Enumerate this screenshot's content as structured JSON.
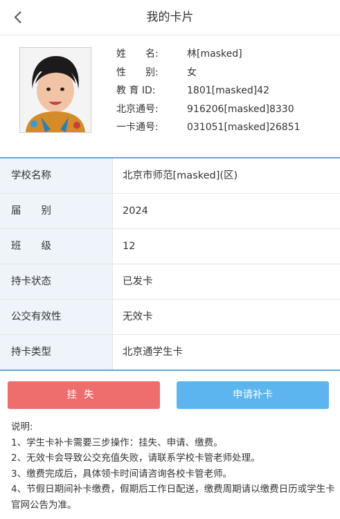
{
  "header": {
    "title": "我的卡片"
  },
  "profile": {
    "fields": [
      {
        "label": "姓　　名:",
        "value": "林[masked]"
      },
      {
        "label": "性　　别:",
        "value": "女"
      },
      {
        "label": "教 育 ID:",
        "value": "1801[masked]42"
      },
      {
        "label": "北京通号:",
        "value": "916206[masked]8330"
      },
      {
        "label": "一卡通号:",
        "value": "031051[masked]26851"
      }
    ]
  },
  "details": {
    "rows": [
      {
        "label": "学校名称",
        "value": "北京市师范[masked](区)"
      },
      {
        "label": "届　　别",
        "value": "2024"
      },
      {
        "label": "班　　级",
        "value": "12"
      },
      {
        "label": "持卡状态",
        "value": "已发卡"
      },
      {
        "label": "公交有效性",
        "value": "无效卡"
      },
      {
        "label": "持卡类型",
        "value": "北京通学生卡"
      }
    ]
  },
  "actions": {
    "report_loss": "挂失",
    "apply_replace": "申请补卡"
  },
  "notes": {
    "heading": "说明:",
    "lines": [
      "1、学生卡补卡需要三步操作：挂失、申请、缴费。",
      "2、无效卡会导致公交充值失败，请联系学校卡管老师处理。",
      "3、缴费完成后，具体领卡时间请咨询各校卡管老师。",
      "4、节假日期间补卡缴费，假期后工作日配送，缴费周期请以缴费日历或学生卡官网公告为准。"
    ]
  },
  "colors": {
    "accent_blue": "#5aa9e6",
    "loss_red": "#ee6e6e",
    "apply_blue": "#5db5ef",
    "label_bg": "#eef4fa"
  }
}
